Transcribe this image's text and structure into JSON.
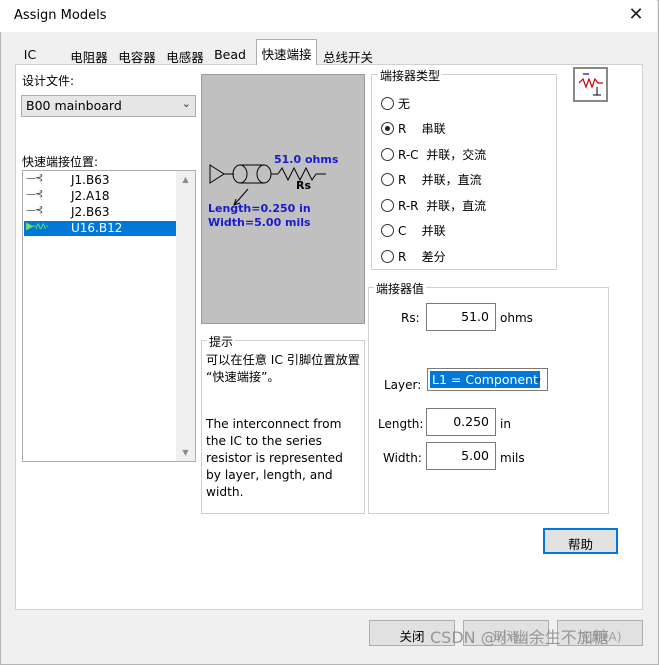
{
  "window": {
    "title": "Assign Models"
  },
  "tabs": [
    {
      "label": "IC"
    },
    {
      "label": "电阻器"
    },
    {
      "label": "电容器"
    },
    {
      "label": "电感器"
    },
    {
      "label": "Bead"
    },
    {
      "label": "快速端接"
    },
    {
      "label": "总线开关"
    }
  ],
  "design_file": {
    "label": "设计文件:",
    "value": "B00 mainboard"
  },
  "positions": {
    "label": "快速端接位置:",
    "items": [
      {
        "icon": "—⊰",
        "label": "J1.B63",
        "selected": false
      },
      {
        "icon": "—⊰",
        "label": "J2.A18",
        "selected": false
      },
      {
        "icon": "—⊰",
        "label": "J2.B63",
        "selected": false
      },
      {
        "icon": "▶-ʌʌ-",
        "label": "U16.B12",
        "selected": true
      }
    ]
  },
  "diagram": {
    "ohms": "51.0 ohms",
    "rs": "Rs",
    "length": "Length=0.250 in",
    "width": "Width=5.00 mils"
  },
  "hint": {
    "title": "提示",
    "line1": "可以在任意 IC 引脚位置放置",
    "line2": "“快速端接”。",
    "p2_1": "The interconnect from",
    "p2_2": "the IC to the series",
    "p2_3": "resistor is represented",
    "p2_4": "by layer, length, and",
    "p2_5": "width."
  },
  "terminator_type": {
    "title": "端接器类型",
    "options": [
      {
        "label": "无",
        "selected": false
      },
      {
        "label": "R    串联",
        "selected": true
      },
      {
        "label": "R-C  并联，交流",
        "selected": false
      },
      {
        "label": "R    并联，直流",
        "selected": false
      },
      {
        "label": "R-R  并联，直流",
        "selected": false
      },
      {
        "label": "C    并联",
        "selected": false
      },
      {
        "label": "R    差分",
        "selected": false
      }
    ]
  },
  "terminator_value": {
    "title": "端接器值",
    "rs_label": "Rs:",
    "rs_value": "51.0",
    "rs_unit": "ohms",
    "layer_label": "Layer:",
    "layer_value": "L1 = Component",
    "length_label": "Length:",
    "length_value": "0.250",
    "length_unit": "in",
    "width_label": "Width:",
    "width_value": "5.00",
    "width_unit": "mils"
  },
  "buttons": {
    "help": "帮助",
    "close": "关闭",
    "cancel": "取消",
    "apply": "应用(A)"
  },
  "watermark": "CSDN @小幽余生不加糖",
  "colors": {
    "selection": "#0078d7",
    "diagram_bg": "#c0c0c0",
    "diagram_text": "#1a1acc"
  }
}
